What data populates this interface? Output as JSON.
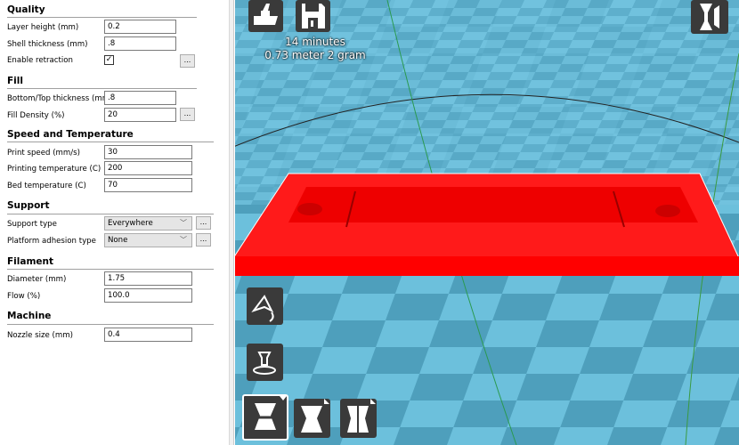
{
  "sections": [
    {
      "title": "Quality",
      "rows": [
        {
          "label": "Layer height (mm)",
          "value": "0.2"
        },
        {
          "label": "Shell thickness (mm)",
          "value": ".8"
        },
        {
          "label": "Enable retraction",
          "checked": true
        }
      ]
    },
    {
      "title": "Fill",
      "rows": [
        {
          "label": "Bottom/Top thickness (mm)",
          "value": ".8"
        },
        {
          "label": "Fill Density (%)",
          "value": "20"
        }
      ]
    },
    {
      "title": "Speed and Temperature",
      "rows": [
        {
          "label": "Print speed (mm/s)",
          "value": "30"
        },
        {
          "label": "Printing temperature (C)",
          "value": "200"
        },
        {
          "label": "Bed temperature (C)",
          "value": "70"
        }
      ]
    },
    {
      "title": "Support",
      "rows": [
        {
          "label": "Support type",
          "value": "Everywhere"
        },
        {
          "label": "Platform adhesion type",
          "value": "None"
        }
      ]
    },
    {
      "title": "Filament",
      "rows": [
        {
          "label": "Diameter (mm)",
          "value": "1.75"
        },
        {
          "label": "Flow (%)",
          "value": "100.0"
        }
      ]
    },
    {
      "title": "Machine",
      "rows": [
        {
          "label": "Nozzle size (mm)",
          "value": "0.4"
        }
      ]
    }
  ],
  "more_label": "...",
  "check_mark": "✓",
  "chevron": "﹀",
  "print_info": {
    "time": "14 minutes",
    "material": "0.73 meter 2 gram"
  },
  "colors": {
    "model": "#ff0000",
    "bed_light": "#6cc0dc",
    "bed_dark": "#4e9fbc",
    "toolbar": "#3a3a3a"
  },
  "icons": [
    "load-icon",
    "save-icon",
    "view-mode-icon",
    "rotate-icon",
    "scale-icon",
    "mirror-icon"
  ]
}
